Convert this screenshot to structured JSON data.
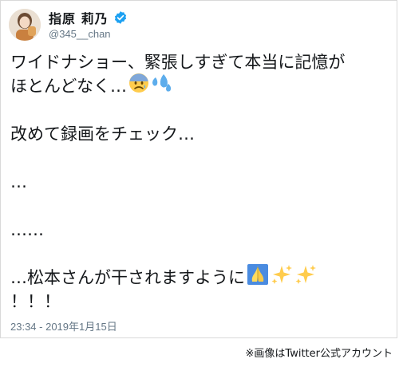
{
  "profile": {
    "display_name": "指原 莉乃",
    "handle": "@345__chan",
    "verified_icon": "verified-badge-icon"
  },
  "tweet": {
    "line1": "ワイドナショー、緊張しすぎて本当に記憶が",
    "line2": "ほとんどなく…",
    "line3": "改めて録画をチェック…",
    "line4": "…",
    "line5": "……",
    "line6": "…松本さんが干されますように",
    "line7": "！！！",
    "emojis": [
      "anxious-face-icon",
      "sweat-droplets-icon",
      "folded-hands-icon",
      "sparkles-icon",
      "sparkles-icon"
    ]
  },
  "timestamp": "23:34 - 2019年1月15日",
  "credit": "※画像はTwitter公式アカウント",
  "colors": {
    "verified": "#1da1f2",
    "secondary_text": "#657786",
    "text": "#14171a",
    "border": "#d9d9d9"
  }
}
